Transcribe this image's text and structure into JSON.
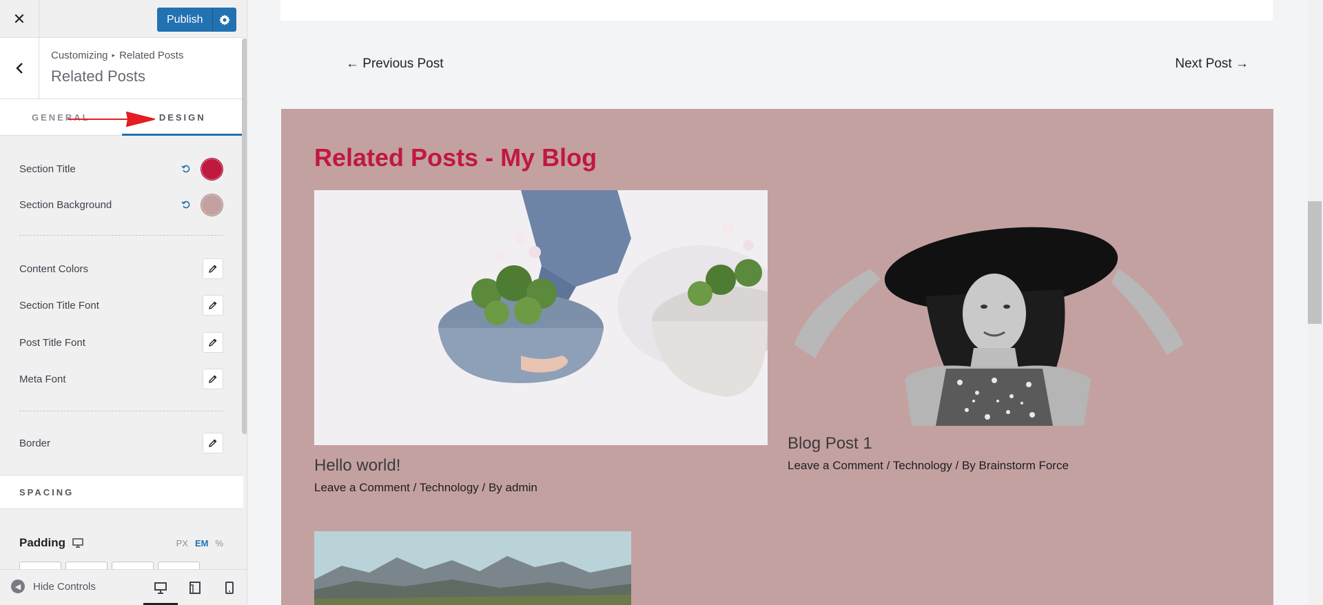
{
  "topbar": {
    "close_icon": "close-icon",
    "publish_label": "Publish",
    "gear_icon": "gear-icon"
  },
  "section": {
    "breadcrumb_root": "Customizing",
    "breadcrumb_sep": "▸",
    "breadcrumb_current": "Related Posts",
    "title": "Related Posts"
  },
  "tabs": [
    {
      "label": "GENERAL",
      "active": false
    },
    {
      "label": "DESIGN",
      "active": true
    }
  ],
  "colors": [
    {
      "label": "Section Title",
      "value": "#c0183f"
    },
    {
      "label": "Section Background",
      "value": "#c4a1a1"
    }
  ],
  "edit_items": [
    {
      "label": "Content Colors"
    },
    {
      "label": "Section Title Font"
    },
    {
      "label": "Post Title Font"
    },
    {
      "label": "Meta Font"
    },
    {
      "label": "Border"
    }
  ],
  "spacing": {
    "heading": "SPACING",
    "padding_label": "Padding",
    "units": [
      "PX",
      "EM",
      "%"
    ],
    "active_unit": "EM"
  },
  "footer": {
    "hide_controls": "Hide Controls",
    "devices": [
      "desktop",
      "tablet",
      "mobile"
    ],
    "active_device": "desktop"
  },
  "preview": {
    "prev_post": "← Previous Post",
    "next_post": "Next Post →",
    "related_title": "Related Posts - My Blog",
    "section_bg": "#c4a1a1",
    "title_color": "#c0183f",
    "posts": [
      {
        "title": "Hello world!",
        "meta_comment": "Leave a Comment",
        "meta_category": "Technology",
        "meta_by": "By",
        "meta_author": "admin",
        "image": "flower pots in knitted baskets"
      },
      {
        "title": "Blog Post 1",
        "meta_comment": "Leave a Comment",
        "meta_category": "Technology",
        "meta_by": "By",
        "meta_author": "Brainstorm Force",
        "image": "woman in black hat"
      },
      {
        "image": "mountain landscape"
      }
    ]
  }
}
